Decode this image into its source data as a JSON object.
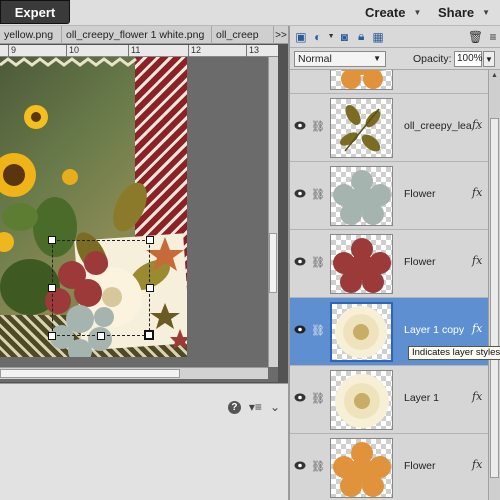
{
  "header": {
    "mode_label": "Expert",
    "create_label": "Create",
    "share_label": "Share"
  },
  "tabs": [
    {
      "label": "yellow.png",
      "close": "×"
    },
    {
      "label": "oll_creepy_flower 1 white.png",
      "close": "×"
    },
    {
      "label": "oll_creep",
      "close": ""
    }
  ],
  "tabs_more": ">>",
  "ruler": {
    "ticks": [
      "9",
      "10",
      "11",
      "12",
      "13"
    ]
  },
  "layers_panel": {
    "blend_mode": "Normal",
    "opacity_label": "Opacity:",
    "opacity_value": "100%",
    "layers": [
      {
        "name": "",
        "fx": "",
        "selected": false,
        "thumb": "orange-flower"
      },
      {
        "name": "oll_creepy_lea...",
        "fx": "fx",
        "selected": false,
        "thumb": "leaves"
      },
      {
        "name": "Flower",
        "fx": "fx",
        "selected": false,
        "thumb": "gray-flower"
      },
      {
        "name": "Flower",
        "fx": "fx",
        "selected": false,
        "thumb": "red-flower"
      },
      {
        "name": "Layer 1 copy",
        "fx": "fx",
        "selected": true,
        "thumb": "cream-flower"
      },
      {
        "name": "Layer 1",
        "fx": "fx",
        "selected": false,
        "thumb": "cream-flower"
      },
      {
        "name": "Flower",
        "fx": "fx",
        "selected": false,
        "thumb": "orange-flower"
      }
    ]
  },
  "tooltip": "Indicates layer styles",
  "colors": {
    "accent": "#5e8fd0",
    "topbar": "#dedede",
    "expert_bg": "#3a3a3a"
  }
}
